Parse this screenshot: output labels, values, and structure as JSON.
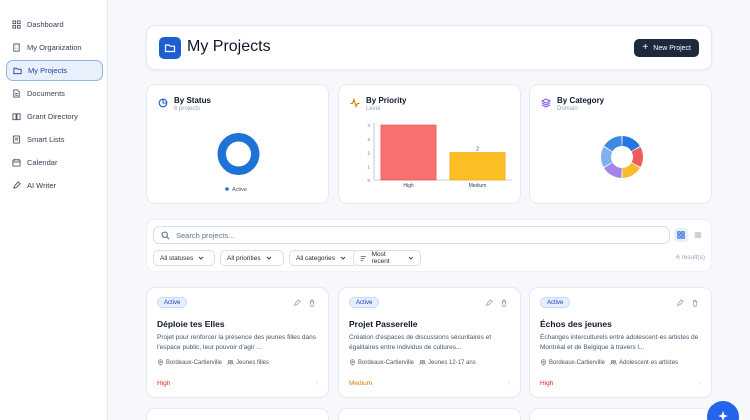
{
  "sidebar": {
    "items": [
      {
        "label": "Dashboard",
        "icon": "grid-icon"
      },
      {
        "label": "My Organization",
        "icon": "building-icon"
      },
      {
        "label": "My Projects",
        "icon": "folder-icon",
        "active": true
      },
      {
        "label": "Documents",
        "icon": "document-icon"
      },
      {
        "label": "Grant Directory",
        "icon": "book-icon"
      },
      {
        "label": "Smart Lists",
        "icon": "list-icon"
      },
      {
        "label": "Calendar",
        "icon": "calendar-icon"
      },
      {
        "label": "AI Writer",
        "icon": "pen-icon"
      }
    ]
  },
  "header": {
    "title": "My Projects",
    "new_button": "New Project"
  },
  "charts": {
    "status": {
      "title": "By Status",
      "subtitle": "6 projects",
      "legend": "Active"
    },
    "priority": {
      "title": "By Priority",
      "subtitle": "Level"
    },
    "category": {
      "title": "By Category",
      "subtitle": "Domain"
    }
  },
  "chart_data": [
    {
      "type": "pie",
      "title": "By Status",
      "labels": [
        "Active"
      ],
      "values": [
        6
      ],
      "colors": [
        "#1e73d6"
      ]
    },
    {
      "type": "bar",
      "title": "By Priority",
      "categories": [
        "High",
        "Medium"
      ],
      "values": [
        4,
        2
      ],
      "ylim": [
        0,
        4
      ],
      "yticks": [
        "0",
        "1",
        "2",
        "3",
        "4"
      ],
      "data_labels": [
        "",
        "2"
      ],
      "colors": [
        "#f87171",
        "#fbbf24"
      ],
      "grid": false
    },
    {
      "type": "pie",
      "title": "By Category",
      "values": [
        1,
        1,
        1,
        1,
        1,
        1
      ],
      "colors": [
        "#2577de",
        "#ef5b5b",
        "#f6bd2a",
        "#a584e8",
        "#7eb1ef",
        "#3f8ae0"
      ]
    }
  ],
  "filters": {
    "search_placeholder": "Search projects...",
    "statuses": "All statuses",
    "priorities": "All priorities",
    "categories": "All categories",
    "sort": "Most recent",
    "results": "6 result(s)"
  },
  "projects": [
    {
      "status": "Active",
      "title": "Déploie tes Elles",
      "description": "Projet pour renforcer la présence des jeunes filles dans l'espace public, leur pouvoir d'agir ...",
      "location": "Bordeaux-Cartierville",
      "audience": "Jeunes filles",
      "priority": "High",
      "priority_color": "#dc2626"
    },
    {
      "status": "Active",
      "title": "Projet Passerelle",
      "description": "Création d'espaces de discussions sécuritaires et égalitaires entre individus de cultures...",
      "location": "Bordeaux-Cartierville",
      "audience": "Jeunes 12-17 ans",
      "priority": "Medium",
      "priority_color": "#d97706"
    },
    {
      "status": "Active",
      "title": "Échos des jeunes",
      "description": "Échanges interculturels entre adolescent·es artistes de Montréal et de Belgique à travers l...",
      "location": "Bordeaux-Cartierville",
      "audience": "Adolescent·es artistes",
      "priority": "High",
      "priority_color": "#dc2626"
    }
  ],
  "colors": {
    "accent": "#1d5fcf",
    "dark_button": "#1e293b",
    "high": "#dc2626",
    "medium": "#d97706"
  }
}
